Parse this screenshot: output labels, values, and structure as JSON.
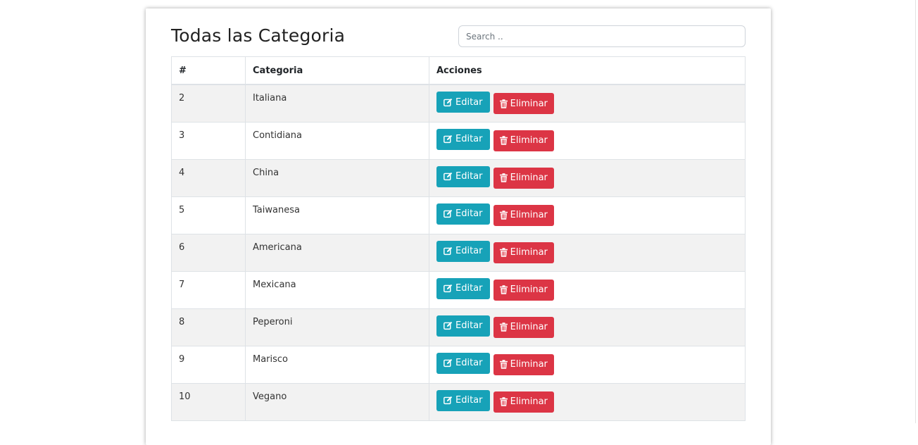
{
  "page": {
    "title": "Todas las Categoria",
    "search_placeholder": "Search .."
  },
  "table": {
    "headers": [
      "#",
      "Categoria",
      "Acciones"
    ],
    "rows": [
      {
        "id": "2",
        "name": "Italiana"
      },
      {
        "id": "3",
        "name": "Contidiana"
      },
      {
        "id": "4",
        "name": "China"
      },
      {
        "id": "5",
        "name": "Taiwanesa"
      },
      {
        "id": "6",
        "name": "Americana"
      },
      {
        "id": "7",
        "name": "Mexicana"
      },
      {
        "id": "8",
        "name": "Peperoni"
      },
      {
        "id": "9",
        "name": "Marisco"
      },
      {
        "id": "10",
        "name": "Vegano"
      }
    ]
  },
  "actions": {
    "edit_label": "Editar",
    "edit_icon": "edit-icon",
    "delete_label": "Eliminar",
    "delete_icon": "trash-icon"
  },
  "colors": {
    "edit": "#17a2b8",
    "delete": "#dc3545",
    "stripe": "#f2f2f2"
  }
}
